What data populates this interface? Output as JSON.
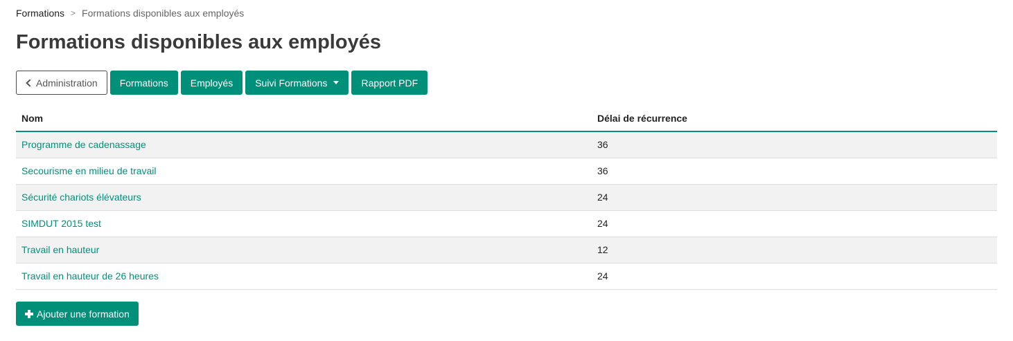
{
  "breadcrumb": {
    "root": "Formations",
    "separator": ">",
    "current": "Formations disponibles aux employés"
  },
  "page": {
    "title": "Formations disponibles aux employés"
  },
  "toolbar": {
    "back_label": "Administration",
    "formations_label": "Formations",
    "employes_label": "Employés",
    "suivi_label": "Suivi Formations",
    "rapport_label": "Rapport PDF"
  },
  "table": {
    "headers": {
      "name": "Nom",
      "delay": "Délai de récurrence"
    },
    "rows": [
      {
        "name": "Programme de cadenassage",
        "delay": "36"
      },
      {
        "name": "Secourisme en milieu de travail",
        "delay": "36"
      },
      {
        "name": "Sécurité chariots élévateurs",
        "delay": "24"
      },
      {
        "name": "SIMDUT 2015 test",
        "delay": "24"
      },
      {
        "name": "Travail en hauteur",
        "delay": "12"
      },
      {
        "name": "Travail en hauteur de 26 heures",
        "delay": "24"
      }
    ]
  },
  "actions": {
    "add_label": "Ajouter une formation"
  },
  "icons": {
    "back": "chevron-left-icon",
    "dropdown": "caret-down-icon",
    "add": "plus-icon"
  },
  "colors": {
    "accent": "#00907a",
    "title": "#3a3a3a",
    "row_stripe": "#f2f2f2"
  }
}
